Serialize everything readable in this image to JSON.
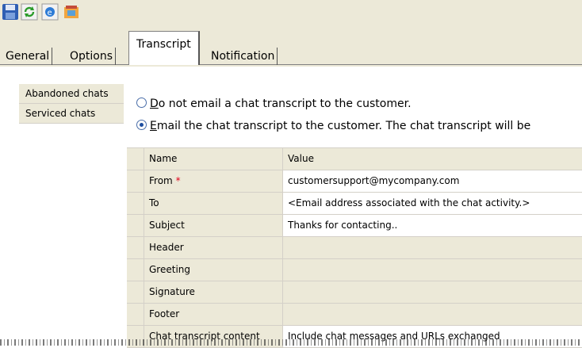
{
  "toolbar": {
    "buttons": [
      {
        "icon": "save-icon"
      },
      {
        "icon": "refresh-icon"
      },
      {
        "icon": "browser-icon"
      },
      {
        "icon": "tools-icon"
      }
    ]
  },
  "tabs": [
    {
      "label": "General"
    },
    {
      "label": "Options"
    },
    {
      "label": "Transcript"
    },
    {
      "label": "Notification"
    }
  ],
  "sidebar": {
    "items": [
      {
        "label": "Abandoned chats"
      },
      {
        "label": "Serviced chats"
      }
    ]
  },
  "options": {
    "no_email": {
      "hot": "D",
      "rest": "o not email a chat transcript to the customer."
    },
    "email": {
      "hot": "E",
      "rest": "mail the chat transcript to the customer. The chat transcript will be"
    }
  },
  "grid": {
    "headers": {
      "name": "Name",
      "value": "Value"
    },
    "rows": [
      {
        "name": "From",
        "required": "*",
        "value": "customersupport@mycompany.com"
      },
      {
        "name": "To",
        "value": "<Email address associated with the chat activity.>"
      },
      {
        "name": "Subject",
        "value": "Thanks for contacting.."
      },
      {
        "name": "Header",
        "value": ""
      },
      {
        "name": "Greeting",
        "value": ""
      },
      {
        "name": "Signature",
        "value": ""
      },
      {
        "name": "Footer",
        "value": ""
      },
      {
        "name": "Chat transcript content",
        "value": "Include chat messages and URLs exchanged"
      }
    ]
  },
  "colors": {
    "chrome": "#ece9d8",
    "required": "#e0001b"
  }
}
